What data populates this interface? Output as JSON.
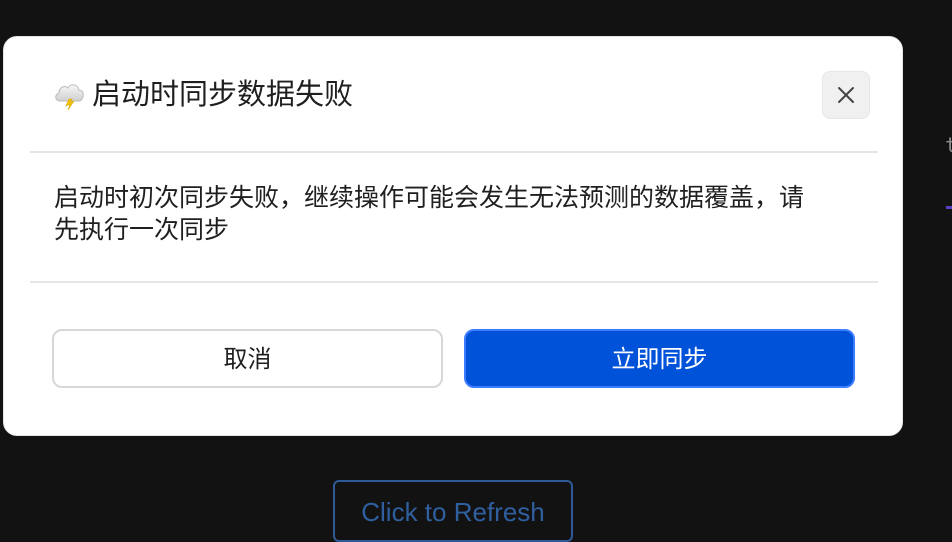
{
  "background": {
    "edge_fragment_text": "t",
    "refresh_button_label": "Click to Refresh"
  },
  "dialog": {
    "title_icon": "thunder-cloud-icon",
    "title": "启动时同步数据失败",
    "close_icon": "close-icon",
    "message": "启动时初次同步失败，继续操作可能会发生无法预测的数据覆盖，请先执行一次同步",
    "cancel_label": "取消",
    "confirm_label": "立即同步"
  },
  "colors": {
    "page_background": "#121212",
    "dialog_background": "#ffffff",
    "primary": "#0052d9",
    "primary_border": "#3e7cff",
    "text": "#1f1f1f",
    "divider": "#e5e5e5",
    "refresh_button": "#2f5f9e"
  }
}
